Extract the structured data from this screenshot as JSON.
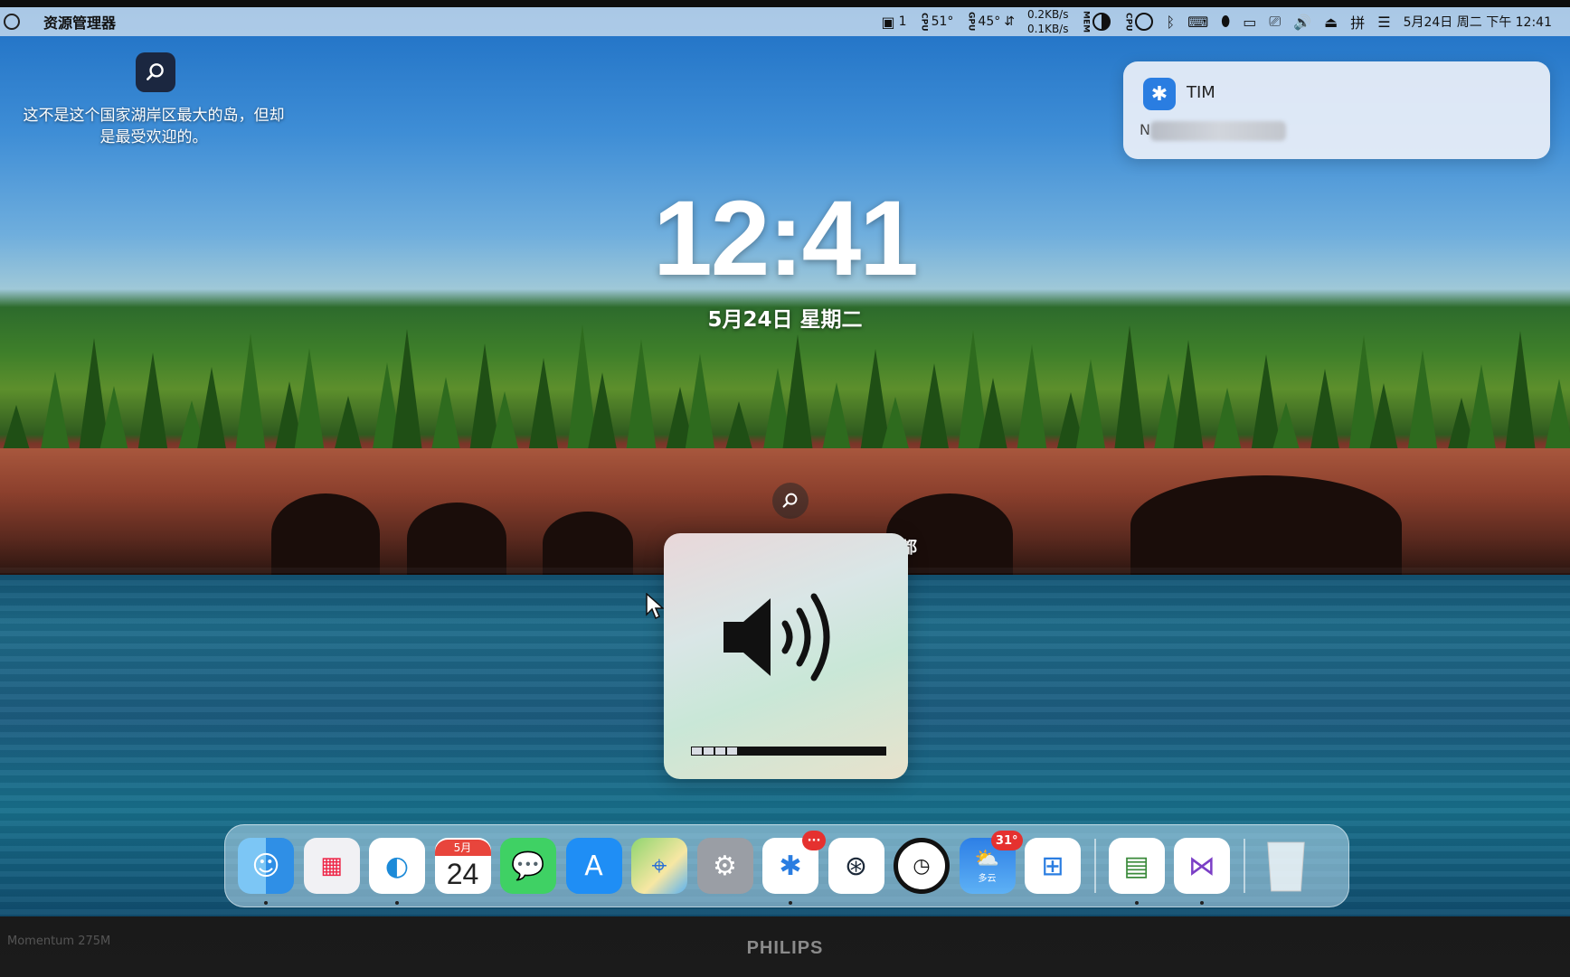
{
  "menubar": {
    "app_title": "资源管理器",
    "window_count": "1",
    "cpu_label": "CPU",
    "cpu_temp": "51°",
    "gpu_label": "GPU",
    "gpu_temp": "45°",
    "net_up": "0.2KB/s",
    "net_down": "0.1KB/s",
    "mem_label": "MEM",
    "cpu2_label": "CPU",
    "datetime": "5月24日 周二 下午 12:41"
  },
  "desktop": {
    "caption": "这不是这个国家湖岸区最大的岛，但却是最受欢迎的。",
    "lock_time": "12:41",
    "lock_date": "5月24日 星期二",
    "hud_char": "都"
  },
  "notification": {
    "app": "TIM",
    "body_initial": "N"
  },
  "volume": {
    "level": 0.25
  },
  "dock": {
    "calendar_month": "5月",
    "calendar_day": "24",
    "tim_badge": "···",
    "weather_badge": "31°",
    "weather_label": "多云"
  },
  "bezel": {
    "model": "Momentum 275M",
    "brand": "PHILIPS"
  },
  "colors": {
    "accent_blue": "#2a7de1",
    "badge_red": "#e5312f"
  }
}
